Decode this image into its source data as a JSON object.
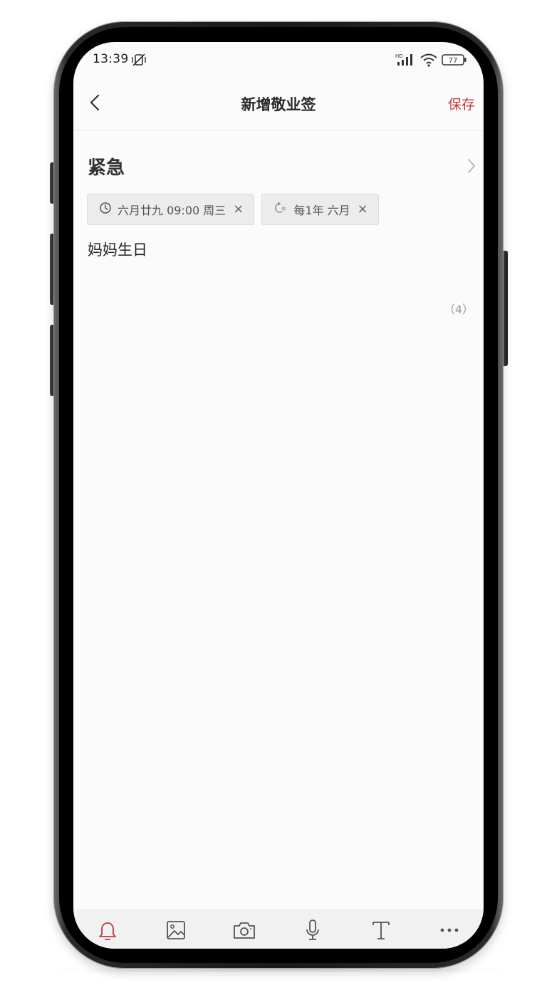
{
  "status_bar": {
    "time": "13:39",
    "battery": "77",
    "network_badge": "HD"
  },
  "header": {
    "title": "新增敬业签",
    "save_label": "保存"
  },
  "category": {
    "title": "紧急"
  },
  "chips": {
    "reminder": {
      "text": "六月廿九 09:00 周三",
      "close": "×"
    },
    "repeat": {
      "text": "每1年 六月",
      "close": "×"
    }
  },
  "note": {
    "body": "妈妈生日",
    "char_count": "（4）"
  },
  "colors": {
    "accent": "#c0393b",
    "screen_bg": "#fbfbfb",
    "toolbar_bg": "#f1f1f1",
    "chip_bg": "#ececec"
  },
  "toolbar": {
    "items": [
      "bell-icon",
      "image-icon",
      "camera-icon",
      "microphone-icon",
      "text-format-icon",
      "more-icon"
    ]
  }
}
